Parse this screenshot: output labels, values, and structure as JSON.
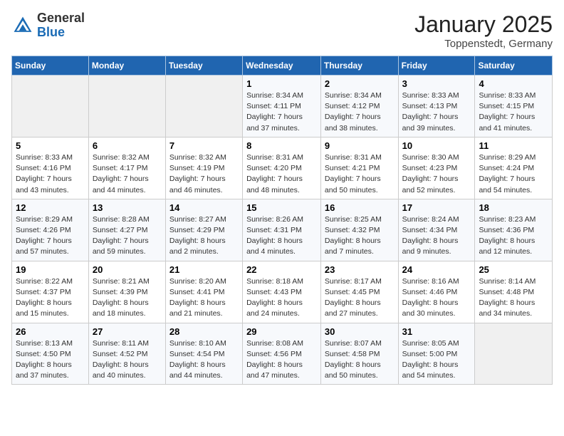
{
  "header": {
    "logo_general": "General",
    "logo_blue": "Blue",
    "title": "January 2025",
    "subtitle": "Toppenstedt, Germany"
  },
  "columns": [
    "Sunday",
    "Monday",
    "Tuesday",
    "Wednesday",
    "Thursday",
    "Friday",
    "Saturday"
  ],
  "weeks": [
    [
      {
        "day": "",
        "info": ""
      },
      {
        "day": "",
        "info": ""
      },
      {
        "day": "",
        "info": ""
      },
      {
        "day": "1",
        "info": "Sunrise: 8:34 AM\nSunset: 4:11 PM\nDaylight: 7 hours\nand 37 minutes."
      },
      {
        "day": "2",
        "info": "Sunrise: 8:34 AM\nSunset: 4:12 PM\nDaylight: 7 hours\nand 38 minutes."
      },
      {
        "day": "3",
        "info": "Sunrise: 8:33 AM\nSunset: 4:13 PM\nDaylight: 7 hours\nand 39 minutes."
      },
      {
        "day": "4",
        "info": "Sunrise: 8:33 AM\nSunset: 4:15 PM\nDaylight: 7 hours\nand 41 minutes."
      }
    ],
    [
      {
        "day": "5",
        "info": "Sunrise: 8:33 AM\nSunset: 4:16 PM\nDaylight: 7 hours\nand 43 minutes."
      },
      {
        "day": "6",
        "info": "Sunrise: 8:32 AM\nSunset: 4:17 PM\nDaylight: 7 hours\nand 44 minutes."
      },
      {
        "day": "7",
        "info": "Sunrise: 8:32 AM\nSunset: 4:19 PM\nDaylight: 7 hours\nand 46 minutes."
      },
      {
        "day": "8",
        "info": "Sunrise: 8:31 AM\nSunset: 4:20 PM\nDaylight: 7 hours\nand 48 minutes."
      },
      {
        "day": "9",
        "info": "Sunrise: 8:31 AM\nSunset: 4:21 PM\nDaylight: 7 hours\nand 50 minutes."
      },
      {
        "day": "10",
        "info": "Sunrise: 8:30 AM\nSunset: 4:23 PM\nDaylight: 7 hours\nand 52 minutes."
      },
      {
        "day": "11",
        "info": "Sunrise: 8:29 AM\nSunset: 4:24 PM\nDaylight: 7 hours\nand 54 minutes."
      }
    ],
    [
      {
        "day": "12",
        "info": "Sunrise: 8:29 AM\nSunset: 4:26 PM\nDaylight: 7 hours\nand 57 minutes."
      },
      {
        "day": "13",
        "info": "Sunrise: 8:28 AM\nSunset: 4:27 PM\nDaylight: 7 hours\nand 59 minutes."
      },
      {
        "day": "14",
        "info": "Sunrise: 8:27 AM\nSunset: 4:29 PM\nDaylight: 8 hours\nand 2 minutes."
      },
      {
        "day": "15",
        "info": "Sunrise: 8:26 AM\nSunset: 4:31 PM\nDaylight: 8 hours\nand 4 minutes."
      },
      {
        "day": "16",
        "info": "Sunrise: 8:25 AM\nSunset: 4:32 PM\nDaylight: 8 hours\nand 7 minutes."
      },
      {
        "day": "17",
        "info": "Sunrise: 8:24 AM\nSunset: 4:34 PM\nDaylight: 8 hours\nand 9 minutes."
      },
      {
        "day": "18",
        "info": "Sunrise: 8:23 AM\nSunset: 4:36 PM\nDaylight: 8 hours\nand 12 minutes."
      }
    ],
    [
      {
        "day": "19",
        "info": "Sunrise: 8:22 AM\nSunset: 4:37 PM\nDaylight: 8 hours\nand 15 minutes."
      },
      {
        "day": "20",
        "info": "Sunrise: 8:21 AM\nSunset: 4:39 PM\nDaylight: 8 hours\nand 18 minutes."
      },
      {
        "day": "21",
        "info": "Sunrise: 8:20 AM\nSunset: 4:41 PM\nDaylight: 8 hours\nand 21 minutes."
      },
      {
        "day": "22",
        "info": "Sunrise: 8:18 AM\nSunset: 4:43 PM\nDaylight: 8 hours\nand 24 minutes."
      },
      {
        "day": "23",
        "info": "Sunrise: 8:17 AM\nSunset: 4:45 PM\nDaylight: 8 hours\nand 27 minutes."
      },
      {
        "day": "24",
        "info": "Sunrise: 8:16 AM\nSunset: 4:46 PM\nDaylight: 8 hours\nand 30 minutes."
      },
      {
        "day": "25",
        "info": "Sunrise: 8:14 AM\nSunset: 4:48 PM\nDaylight: 8 hours\nand 34 minutes."
      }
    ],
    [
      {
        "day": "26",
        "info": "Sunrise: 8:13 AM\nSunset: 4:50 PM\nDaylight: 8 hours\nand 37 minutes."
      },
      {
        "day": "27",
        "info": "Sunrise: 8:11 AM\nSunset: 4:52 PM\nDaylight: 8 hours\nand 40 minutes."
      },
      {
        "day": "28",
        "info": "Sunrise: 8:10 AM\nSunset: 4:54 PM\nDaylight: 8 hours\nand 44 minutes."
      },
      {
        "day": "29",
        "info": "Sunrise: 8:08 AM\nSunset: 4:56 PM\nDaylight: 8 hours\nand 47 minutes."
      },
      {
        "day": "30",
        "info": "Sunrise: 8:07 AM\nSunset: 4:58 PM\nDaylight: 8 hours\nand 50 minutes."
      },
      {
        "day": "31",
        "info": "Sunrise: 8:05 AM\nSunset: 5:00 PM\nDaylight: 8 hours\nand 54 minutes."
      },
      {
        "day": "",
        "info": ""
      }
    ]
  ]
}
